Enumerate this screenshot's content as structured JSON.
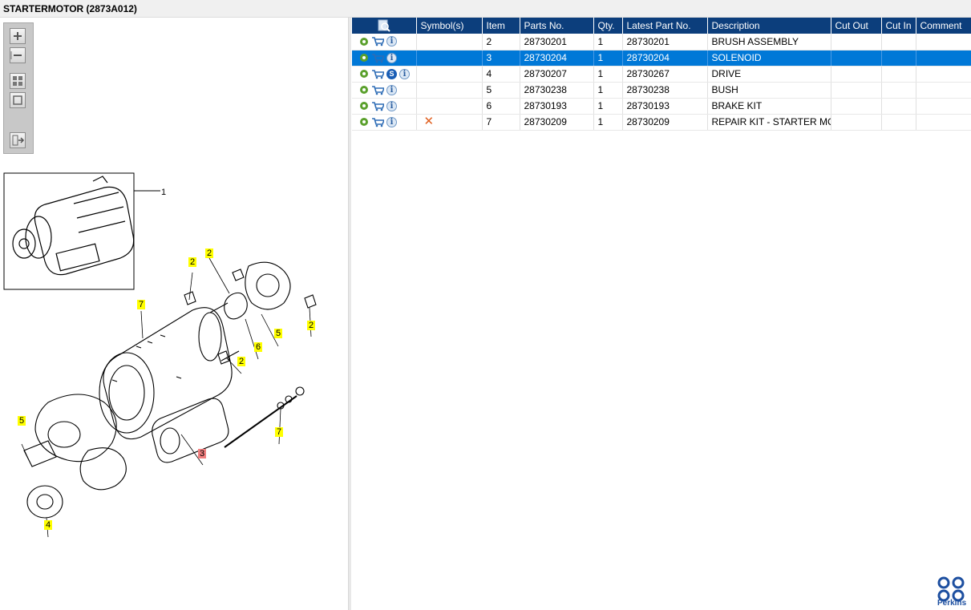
{
  "window": {
    "title": "STARTERMOTOR (2873A012)"
  },
  "toolbar": {
    "buttons": [
      {
        "name": "zoom-in-icon"
      },
      {
        "name": "zoom-out-icon"
      },
      {
        "name": "fit-all-icon"
      },
      {
        "name": "actual-size-icon"
      },
      {
        "name": "export-icon"
      }
    ]
  },
  "drawing": {
    "callouts": {
      "c1": "1",
      "c2a": "2",
      "c2b": "2",
      "c2c": "2",
      "c2d": "2",
      "c7a": "7",
      "c6": "6",
      "c5a": "5",
      "c5b": "5",
      "c3": "3",
      "c7b": "7",
      "c4": "4"
    }
  },
  "table": {
    "headers": {
      "symbols": "Symbol(s)",
      "item": "Item",
      "parts_no": "Parts No.",
      "qty": "Qty.",
      "latest_part_no": "Latest Part No.",
      "description": "Description",
      "cut_out": "Cut Out",
      "cut_in": "Cut In",
      "comment": "Comment"
    },
    "rows": [
      {
        "item": "2",
        "parts_no": "28730201",
        "qty": "1",
        "latest_part_no": "28730201",
        "description": "BRUSH ASSEMBLY",
        "cut_out": "",
        "cut_in": "",
        "comment": ""
      },
      {
        "item": "3",
        "parts_no": "28730204",
        "qty": "1",
        "latest_part_no": "28730204",
        "description": "SOLENOID",
        "cut_out": "",
        "cut_in": "",
        "comment": ""
      },
      {
        "item": "4",
        "parts_no": "28730207",
        "qty": "1",
        "latest_part_no": "28730267",
        "description": "DRIVE",
        "cut_out": "",
        "cut_in": "",
        "comment": ""
      },
      {
        "item": "5",
        "parts_no": "28730238",
        "qty": "1",
        "latest_part_no": "28730238",
        "description": "BUSH",
        "cut_out": "",
        "cut_in": "",
        "comment": ""
      },
      {
        "item": "6",
        "parts_no": "28730193",
        "qty": "1",
        "latest_part_no": "28730193",
        "description": "BRAKE KIT",
        "cut_out": "",
        "cut_in": "",
        "comment": ""
      },
      {
        "item": "7",
        "parts_no": "28730209",
        "qty": "1",
        "latest_part_no": "28730209",
        "description": "REPAIR KIT - STARTER MOTOR",
        "cut_out": "",
        "cut_in": "",
        "comment": ""
      }
    ],
    "row_icons": {
      "settings": "gear-icon",
      "cart": "cart-icon",
      "info": "i",
      "supersession": "S",
      "cross": "✕"
    }
  },
  "brand": {
    "logo_text": "Perkins",
    "color": "#1d4fa0"
  },
  "colors": {
    "header": "#0c3e7c",
    "selection": "#0078d7",
    "callout": "#ffff00",
    "callout_highlight": "#f28080"
  }
}
